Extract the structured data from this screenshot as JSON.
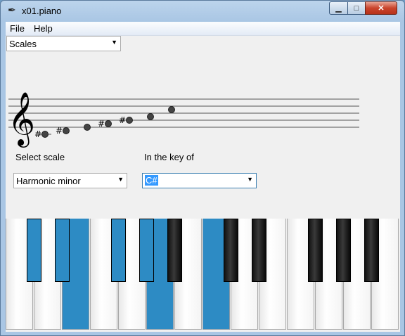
{
  "window": {
    "title": "x01.piano",
    "icon": "feather-pen-icon"
  },
  "controls": {
    "minimize": "minimize-icon",
    "maximize": "maximize-icon",
    "close": "close-icon"
  },
  "menu": {
    "file": "File",
    "help": "Help"
  },
  "mode_select": {
    "value": "Scales"
  },
  "staff": {
    "clef": "treble",
    "notes": [
      {
        "name": "C#4",
        "sharp": true
      },
      {
        "name": "D#4",
        "sharp": true
      },
      {
        "name": "E4",
        "sharp": false
      },
      {
        "name": "F#4",
        "sharp": true
      },
      {
        "name": "G#4",
        "sharp": true
      },
      {
        "name": "A4",
        "sharp": false
      },
      {
        "name": "B#4",
        "sharp": false
      }
    ]
  },
  "scale_select": {
    "label": "Select scale",
    "value": "Harmonic minor"
  },
  "key_select": {
    "label": "In the key of",
    "value": "C#"
  },
  "colors": {
    "highlight": "#2d8bc4"
  },
  "piano": {
    "white_keys": [
      {
        "on": false
      },
      {
        "on": false
      },
      {
        "on": true
      },
      {
        "on": false
      },
      {
        "on": false
      },
      {
        "on": true
      },
      {
        "on": false
      },
      {
        "on": true
      },
      {
        "on": false
      },
      {
        "on": false
      },
      {
        "on": false
      },
      {
        "on": false
      },
      {
        "on": false
      },
      {
        "on": false
      }
    ],
    "black_keys": [
      {
        "on": true
      },
      {
        "on": true
      },
      {
        "on": true
      },
      {
        "on": true
      },
      {
        "on": false
      },
      {
        "on": false
      },
      {
        "on": false
      },
      {
        "on": false
      },
      {
        "on": false
      },
      {
        "on": false
      }
    ]
  }
}
